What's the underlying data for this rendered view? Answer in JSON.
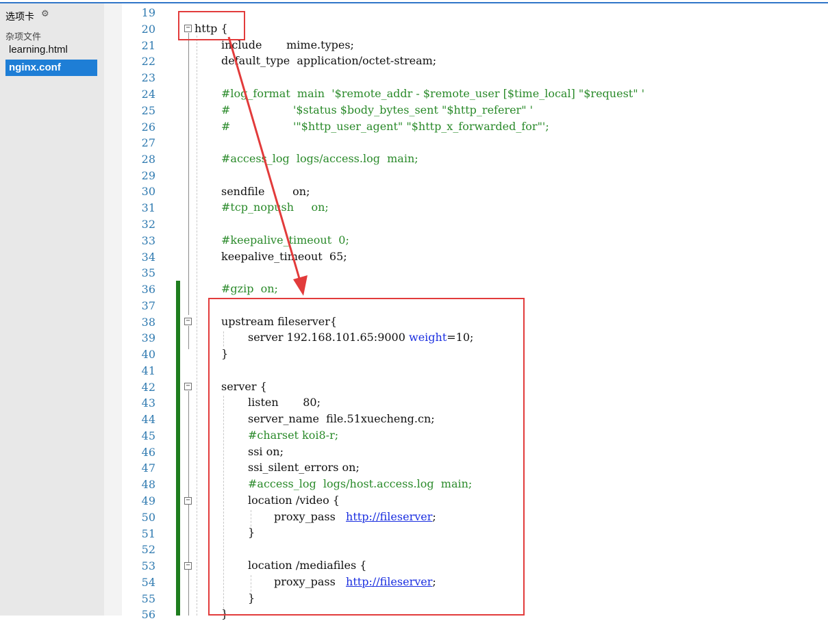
{
  "sidebar": {
    "title": "选项卡",
    "gear_icon": "⚙",
    "group_label": "杂项文件",
    "files": [
      {
        "label": "learning.html",
        "active": false
      },
      {
        "label": "nginx.conf",
        "active": true
      }
    ]
  },
  "editor": {
    "line_numbers": [
      "19",
      "20",
      "21",
      "22",
      "23",
      "24",
      "25",
      "26",
      "27",
      "28",
      "29",
      "30",
      "31",
      "32",
      "33",
      "34",
      "35",
      "36",
      "37",
      "38",
      "39",
      "40",
      "41",
      "42",
      "43",
      "44",
      "45",
      "46",
      "47",
      "48",
      "49",
      "50",
      "51",
      "52",
      "53",
      "54",
      "55",
      "56"
    ],
    "lines": [
      {
        "n": "20",
        "text": "http {"
      },
      {
        "n": "21",
        "text": "include       mime.types;"
      },
      {
        "n": "22",
        "text": "default_type  application/octet-stream;"
      },
      {
        "n": "24",
        "text": "#log_format  main  '$remote_addr - $remote_user [$time_local] \"$request\" '"
      },
      {
        "n": "25",
        "text": "#                  '$status $body_bytes_sent \"$http_referer\" '"
      },
      {
        "n": "26",
        "text": "#                  '\"$http_user_agent\" \"$http_x_forwarded_for\"';"
      },
      {
        "n": "28",
        "text": "#access_log  logs/access.log  main;"
      },
      {
        "n": "30",
        "text": "sendfile        on;"
      },
      {
        "n": "31",
        "text": "#tcp_nopush     on;"
      },
      {
        "n": "33",
        "text": "#keepalive_timeout  0;"
      },
      {
        "n": "34",
        "text": "keepalive_timeout  65;"
      },
      {
        "n": "36",
        "text": "#gzip  on;"
      },
      {
        "n": "38",
        "text": "upstream fileserver{"
      },
      {
        "n": "39a",
        "text": "server 192.168.101.65:9000 "
      },
      {
        "n": "39b",
        "text": "weight"
      },
      {
        "n": "39c",
        "text": "=10;"
      },
      {
        "n": "40",
        "text": "}"
      },
      {
        "n": "42",
        "text": "server {"
      },
      {
        "n": "43",
        "text": "listen       80;"
      },
      {
        "n": "44",
        "text": "server_name  file.51xuecheng.cn;"
      },
      {
        "n": "45",
        "text": "#charset koi8-r;"
      },
      {
        "n": "46",
        "text": "ssi on;"
      },
      {
        "n": "47",
        "text": "ssi_silent_errors on;"
      },
      {
        "n": "48",
        "text": "#access_log  logs/host.access.log  main;"
      },
      {
        "n": "49",
        "text": "location /video {"
      },
      {
        "n": "50a",
        "text": "proxy_pass   "
      },
      {
        "n": "50b",
        "text": "http://fileserver"
      },
      {
        "n": "50c",
        "text": ";"
      },
      {
        "n": "51",
        "text": "}"
      },
      {
        "n": "53",
        "text": "location /mediafiles {"
      },
      {
        "n": "54a",
        "text": "proxy_pass   "
      },
      {
        "n": "54b",
        "text": "http://fileserver"
      },
      {
        "n": "54c",
        "text": ";"
      },
      {
        "n": "55",
        "text": "}"
      },
      {
        "n": "56",
        "text": "}"
      }
    ]
  },
  "colors": {
    "comment": "#2a8a2a",
    "url": "#1a2ee0",
    "line_number": "#2f7ab0",
    "change_bar": "#1e7d1e",
    "annotation": "#e23b3b",
    "selected_tab": "#1e7ed6"
  }
}
